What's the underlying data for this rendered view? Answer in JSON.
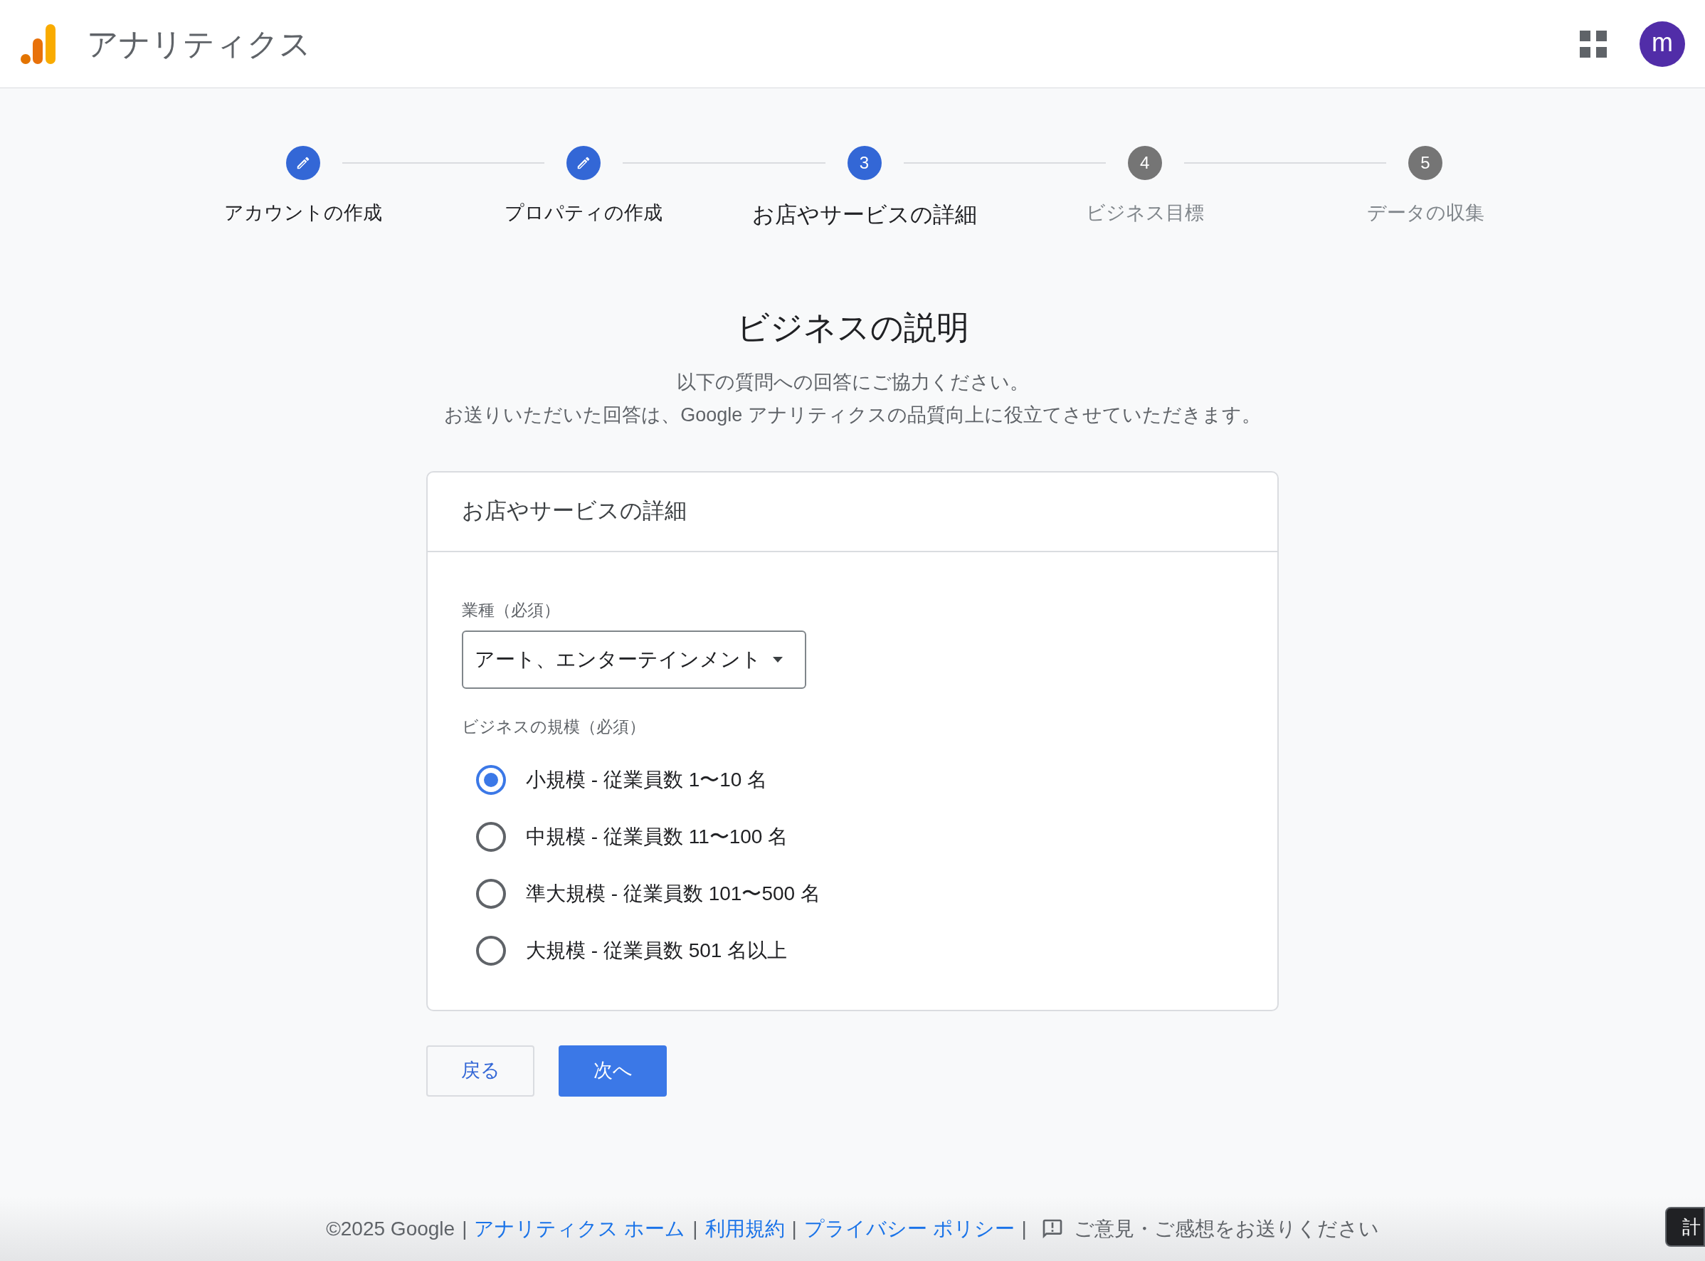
{
  "header": {
    "title": "アナリティクス",
    "avatar": "m"
  },
  "steps": [
    {
      "label": "アカウントの作成",
      "kind": "done"
    },
    {
      "label": "プロパティの作成",
      "kind": "done"
    },
    {
      "label": "お店やサービスの詳細",
      "number": "3",
      "kind": "current"
    },
    {
      "label": "ビジネス目標",
      "number": "4",
      "kind": "upcoming"
    },
    {
      "label": "データの収集",
      "number": "5",
      "kind": "upcoming"
    }
  ],
  "heading": "ビジネスの説明",
  "description": [
    "以下の質問への回答にご協力ください。",
    "お送りいただいた回答は、Google アナリティクスの品質向上に役立てさせていただきます。"
  ],
  "card": {
    "title": "お店やサービスの詳細",
    "industry": {
      "label": "業種（必須）",
      "value": "アート、エンターテインメント"
    },
    "size": {
      "label": "ビジネスの規模（必須）",
      "options": [
        {
          "label": "小規模 - 従業員数 1〜10 名",
          "selected": true
        },
        {
          "label": "中規模 - 従業員数 11〜100 名",
          "selected": false
        },
        {
          "label": "準大規模 - 従業員数 101〜500 名",
          "selected": false
        },
        {
          "label": "大規模 - 従業員数 501 名以上",
          "selected": false
        }
      ]
    }
  },
  "buttons": {
    "back": "戻る",
    "next": "次へ"
  },
  "footer": [
    {
      "kind": "text",
      "text": "©2025 Google"
    },
    {
      "kind": "separator",
      "text": "|"
    },
    {
      "kind": "link",
      "text": "アナリティクス ホーム"
    },
    {
      "kind": "separator",
      "text": "|"
    },
    {
      "kind": "link",
      "text": "利用規約"
    },
    {
      "kind": "separator",
      "text": "|"
    },
    {
      "kind": "link",
      "text": "プライバシー ポリシー"
    },
    {
      "kind": "separator",
      "text": "|"
    },
    {
      "kind": "feedback",
      "text": "ご意見・ご感想をお送りください"
    }
  ],
  "corner_button": "計"
}
